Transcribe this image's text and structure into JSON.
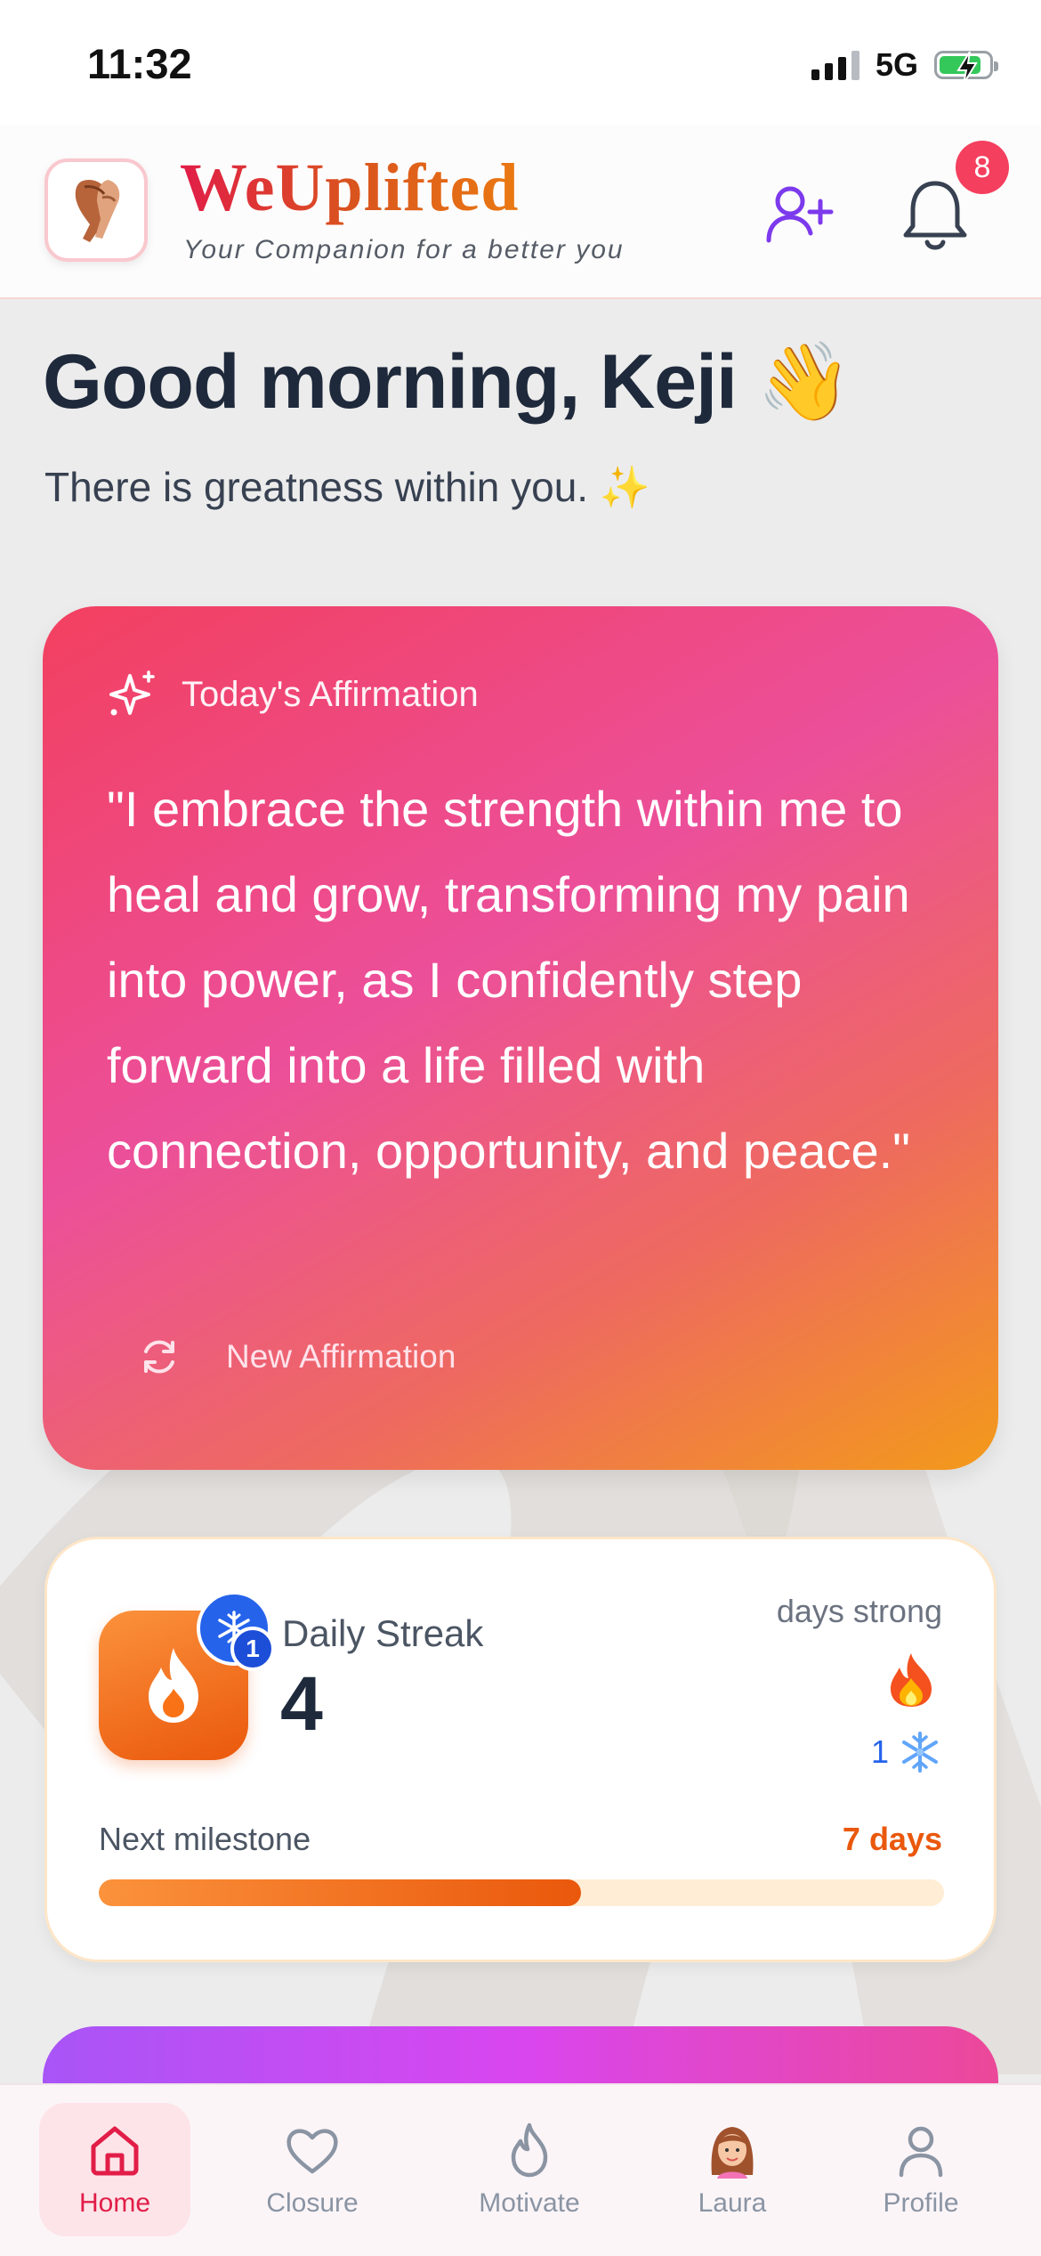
{
  "status_bar": {
    "time": "11:32",
    "network": "5G",
    "battery_level": 0.85
  },
  "header": {
    "app_name": "WeUplifted",
    "tagline": "Your Companion for a better you",
    "logo_icon": "clasped-hands-logo",
    "add_friend_icon": "user-plus-icon",
    "notifications_icon": "bell-icon",
    "notification_count": "8"
  },
  "greeting": {
    "title": "Good morning, Keji 👋",
    "subtitle": "There is greatness within you. ✨"
  },
  "affirmation": {
    "label": "Today's Affirmation",
    "text": "\"I embrace the strength within me to heal and grow, transforming my pain into power, as I confidently step forward into a life filled with connection, opportunity, and peace.\"",
    "new_button": "New Affirmation"
  },
  "streak": {
    "title": "Daily Streak",
    "value": "4",
    "freeze_badge_count": "1",
    "days_label": "days strong",
    "fire_emoji": "🔥",
    "freeze_count": "1",
    "freeze_emoji": "❄️",
    "milestone_label": "Next milestone",
    "milestone_value": "7 days",
    "progress": 0.57
  },
  "nav": {
    "items": [
      {
        "label": "Home",
        "icon": "home-icon",
        "active": true
      },
      {
        "label": "Closure",
        "icon": "heart-icon",
        "active": false
      },
      {
        "label": "Motivate",
        "icon": "flame-icon",
        "active": false
      },
      {
        "label": "Laura",
        "icon": "laura-avatar-icon",
        "active": false
      },
      {
        "label": "Profile",
        "icon": "profile-icon",
        "active": false
      }
    ]
  },
  "colors": {
    "brand_red": "#e11d48",
    "accent_purple": "#7c3aed",
    "streak_orange": "#ea580c",
    "badge_red": "#f43f5e",
    "freeze_blue": "#2563eb"
  }
}
